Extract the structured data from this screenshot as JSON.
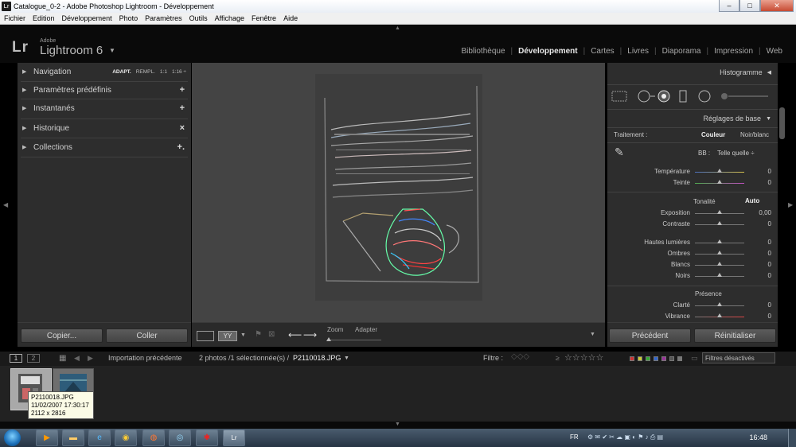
{
  "window": {
    "title": "Catalogue_0-2 - Adobe Photoshop Lightroom - Développement",
    "app_badge": "Lr",
    "controls": [
      "–",
      "□",
      "✕"
    ]
  },
  "menubar": [
    "Fichier",
    "Edition",
    "Développement",
    "Photo",
    "Paramètres",
    "Outils",
    "Affichage",
    "Fenêtre",
    "Aide"
  ],
  "header": {
    "logo": "Lr",
    "adobe": "Adobe",
    "product": "Lightroom 6",
    "dropdown": "▼",
    "modules": [
      "Bibliothèque",
      "Développement",
      "Cartes",
      "Livres",
      "Diaporama",
      "Impression",
      "Web"
    ],
    "active_module": "Développement"
  },
  "left_panel": {
    "navigation": {
      "label": "Navigation",
      "options": [
        "ADAPT.",
        "REMPL.",
        "1:1",
        "1:16 ÷"
      ]
    },
    "presets": {
      "label": "Paramètres prédéfinis",
      "action": "+"
    },
    "snapshots": {
      "label": "Instantanés",
      "action": "+"
    },
    "history": {
      "label": "Historique",
      "action": "×"
    },
    "collections": {
      "label": "Collections",
      "action": "+."
    },
    "copy_button": "Copier...",
    "paste_button": "Coller"
  },
  "toolbar": {
    "zoom_label": "Zoom",
    "zoom_value": "Adapter",
    "compare_label": "YY",
    "prev_arrow": "⟵",
    "next_arrow": "⟶"
  },
  "right_panel": {
    "histogram": "Histogramme",
    "basic": "Réglages de base",
    "treatment_label": "Traitement :",
    "treatment_color": "Couleur",
    "treatment_bw": "Noir/blanc",
    "wb_label": "BB :",
    "wb_value": "Telle quelle ÷",
    "sliders_wb": [
      {
        "label": "Température",
        "value": "0"
      },
      {
        "label": "Teinte",
        "value": "0"
      }
    ],
    "tone_label": "Tonalité",
    "auto_label": "Auto",
    "sliders_tone": [
      {
        "label": "Exposition",
        "value": "0,00"
      },
      {
        "label": "Contraste",
        "value": "0"
      }
    ],
    "sliders_tone2": [
      {
        "label": "Hautes lumières",
        "value": "0"
      },
      {
        "label": "Ombres",
        "value": "0"
      },
      {
        "label": "Blancs",
        "value": "0"
      },
      {
        "label": "Noirs",
        "value": "0"
      }
    ],
    "presence_label": "Présence",
    "sliders_presence": [
      {
        "label": "Clarté",
        "value": "0"
      },
      {
        "label": "Vibrance",
        "value": "0"
      }
    ],
    "previous_button": "Précédent",
    "reset_button": "Réinitialiser"
  },
  "filmstrip_header": {
    "monitor1": "1",
    "monitor2": "2",
    "source": "Importation précédente",
    "selection": "2 photos /1 sélectionnée(s) /",
    "filename": "P2110018.JPG",
    "filter_label": "Filtre :",
    "filter_value": "Filtres désactivés",
    "stars": "☆☆☆☆☆"
  },
  "tooltip": {
    "filename": "P2110018.JPG",
    "date": "11/02/2007 17:30:17",
    "size": "2112 x 2816"
  },
  "taskbar": {
    "language": "FR",
    "time": "16:48"
  }
}
